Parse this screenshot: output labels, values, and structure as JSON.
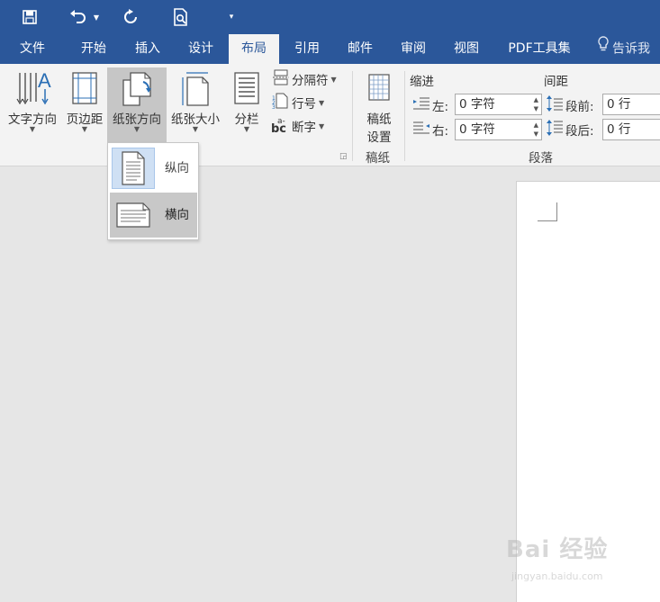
{
  "quick_access": {
    "save_icon": "save-icon",
    "undo_icon": "undo-icon",
    "redo_icon": "repeat-icon",
    "print_preview_icon": "print-preview-icon",
    "customize_icon": "customize-qat-icon"
  },
  "tabs": [
    {
      "label": "文件"
    },
    {
      "label": "开始"
    },
    {
      "label": "插入"
    },
    {
      "label": "设计"
    },
    {
      "label": "布局",
      "active": true
    },
    {
      "label": "引用"
    },
    {
      "label": "邮件"
    },
    {
      "label": "审阅"
    },
    {
      "label": "视图"
    },
    {
      "label": "PDF工具集"
    }
  ],
  "tell_me": "告诉我",
  "page_setup": {
    "text_direction": "文字方向",
    "margins": "页边距",
    "orientation": "纸张方向",
    "size": "纸张大小",
    "columns": "分栏",
    "breaks": "分隔符",
    "line_numbers": "行号",
    "hyphenation": "断字",
    "hyphenation_icon_text": "bc",
    "hyphenation_icon_sup": "a-"
  },
  "manuscript": {
    "button_line1": "稿纸",
    "button_line2": "设置",
    "group_label": "稿纸"
  },
  "paragraph": {
    "indent_label": "缩进",
    "spacing_label": "间距",
    "left_label": "左:",
    "right_label": "右:",
    "before_label": "段前:",
    "after_label": "段后:",
    "left_value": "0 字符",
    "right_value": "0 字符",
    "before_value": "0 行",
    "after_value": "0 行",
    "group_label": "段落"
  },
  "orientation_menu": {
    "portrait": "纵向",
    "landscape": "横向",
    "selected": "portrait",
    "hovered": "landscape"
  },
  "watermark": {
    "brand": "Bai 经验",
    "url": "jingyan.baidu.com"
  },
  "colors": {
    "brand": "#2b579a",
    "ribbon_bg": "#f3f3f3",
    "selected_button": "#c6c6c6",
    "canvas": "#e6e6e6"
  }
}
